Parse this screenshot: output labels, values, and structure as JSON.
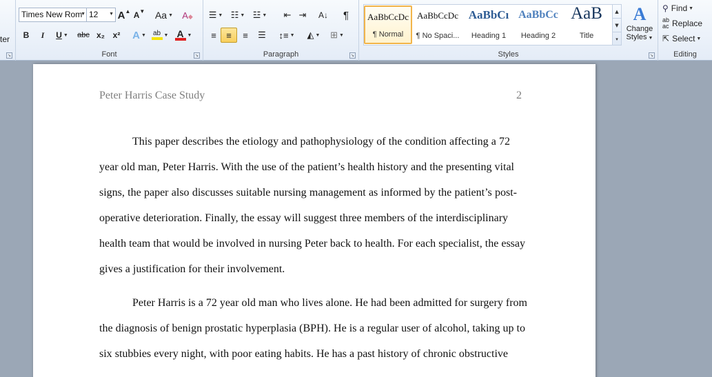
{
  "ribbon": {
    "clipboard_fragment": "ter",
    "font": {
      "label": "Font",
      "family": "Times New Rom",
      "size": "12",
      "grow_glyph": "A",
      "shrink_glyph": "A",
      "case_glyph": "Aa",
      "bold": "B",
      "italic": "I",
      "underline": "U",
      "strike": "abc",
      "subscript": "x₂",
      "superscript": "x²",
      "effects_glyph": "A",
      "highlight_glyph": "ab",
      "color_glyph": "A"
    },
    "paragraph": {
      "label": "Paragraph",
      "pilcrow": "¶"
    },
    "styles": {
      "label": "Styles",
      "items": [
        {
          "sample": "AaBbCcDc",
          "name": "¶ Normal"
        },
        {
          "sample": "AaBbCcDc",
          "name": "¶ No Spaci..."
        },
        {
          "sample": "AaBbCı",
          "name": "Heading 1"
        },
        {
          "sample": "AaBbCc",
          "name": "Heading 2"
        },
        {
          "sample": "AaB",
          "name": "Title"
        }
      ],
      "change_styles_line1": "Change",
      "change_styles_line2": "Styles"
    },
    "editing": {
      "label": "Editing",
      "find": "Find",
      "replace": "Replace",
      "select": "Select"
    },
    "colors": {
      "highlight": "#f5e400",
      "font_color": "#e02020",
      "accent": "#f1b44a"
    }
  },
  "document": {
    "header": "Peter Harris Case Study",
    "page_number": "2",
    "lines": [
      "This paper describes the etiology and pathophysiology of the condition affecting a 72",
      "year old man, Peter Harris. With the use of the patient’s health history and the presenting vital",
      "signs, the paper also discusses suitable nursing management as informed by the patient’s post-",
      "operative deterioration. Finally, the essay will suggest three members of the interdisciplinary",
      "health team that would be involved in nursing Peter back to health. For each specialist, the essay",
      "gives a justification for their involvement.",
      "Peter Harris is a 72 year old man who lives alone. He had been admitted for surgery from",
      "the diagnosis of benign prostatic hyperplasia (BPH). He is a regular user of alcohol, taking up to",
      "six stubbies every night, with poor eating habits. He has a past history of chronic obstructive"
    ]
  }
}
